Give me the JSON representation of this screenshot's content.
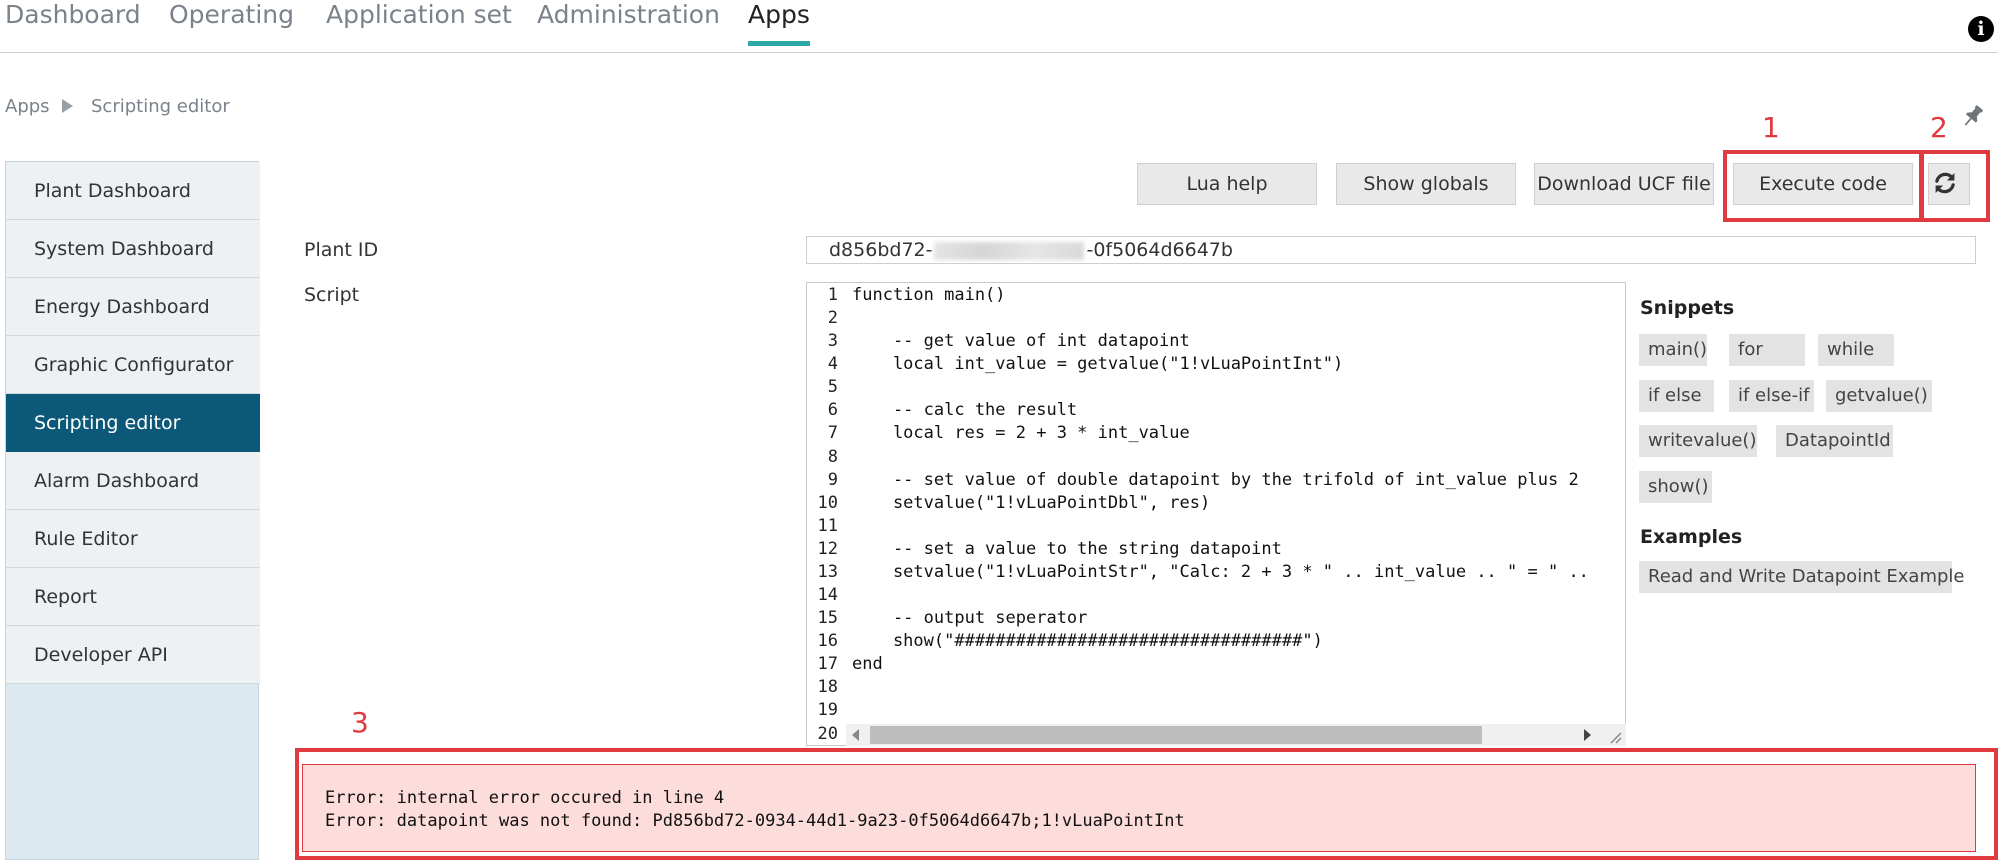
{
  "topnav": {
    "items": [
      {
        "label": "Dashboard",
        "active": false
      },
      {
        "label": "Operating",
        "active": false
      },
      {
        "label": "Application set",
        "active": false
      },
      {
        "label": "Administration",
        "active": false
      },
      {
        "label": "Apps",
        "active": true
      }
    ]
  },
  "breadcrumb": {
    "root": "Apps",
    "current": "Scripting editor"
  },
  "sidebar": {
    "items": [
      {
        "label": "Plant Dashboard"
      },
      {
        "label": "System Dashboard"
      },
      {
        "label": "Energy Dashboard"
      },
      {
        "label": "Graphic Configurator"
      },
      {
        "label": "Scripting editor",
        "active": true
      },
      {
        "label": "Alarm Dashboard"
      },
      {
        "label": "Rule Editor"
      },
      {
        "label": "Report"
      },
      {
        "label": "Developer API"
      }
    ]
  },
  "toolbar": {
    "lua_help": "Lua help",
    "show_globals": "Show globals",
    "download_ucf": "Download UCF file",
    "execute_code": "Execute code"
  },
  "annotations": {
    "n1": "1",
    "n2": "2",
    "n3": "3"
  },
  "form": {
    "plant_id_label": "Plant ID",
    "plant_id_prefix": "d856bd72-",
    "plant_id_suffix": "-0f5064d6647b",
    "script_label": "Script"
  },
  "editor": {
    "line_numbers": [
      "1",
      "2",
      "3",
      "4",
      "5",
      "6",
      "7",
      "8",
      "9",
      "10",
      "11",
      "12",
      "13",
      "14",
      "15",
      "16",
      "17",
      "18",
      "19",
      "20"
    ],
    "lines": [
      "function main()",
      "",
      "    -- get value of int datapoint",
      "    local int_value = getvalue(\"1!vLuaPointInt\")",
      "",
      "    -- calc the result",
      "    local res = 2 + 3 * int_value",
      "",
      "    -- set value of double datapoint by the trifold of int_value plus 2",
      "    setvalue(\"1!vLuaPointDbl\", res)",
      "",
      "    -- set a value to the string datapoint",
      "    setvalue(\"1!vLuaPointStr\", \"Calc: 2 + 3 * \" .. int_value .. \" = \" ..",
      "",
      "    -- output seperator",
      "    show(\"##################################\")",
      "end",
      "",
      "",
      ""
    ]
  },
  "snippets": {
    "title": "Snippets",
    "chips": [
      "main()",
      "for",
      "while",
      "if else",
      "if else-if",
      "getvalue()",
      "writevalue()",
      "DatapointId",
      "show()"
    ]
  },
  "examples": {
    "title": "Examples",
    "chips": [
      "Read and Write Datapoint Example"
    ]
  },
  "error": {
    "lines": [
      "Error: internal error occured in line 4",
      "Error: datapoint was not found: Pd856bd72-0934-44d1-9a23-0f5064d6647b;1!vLuaPointInt"
    ]
  },
  "colors": {
    "accent": "#2aa9a6",
    "sidebar_active": "#0b5878",
    "annotation": "#e0393f",
    "error_bg": "#fddcdc"
  }
}
